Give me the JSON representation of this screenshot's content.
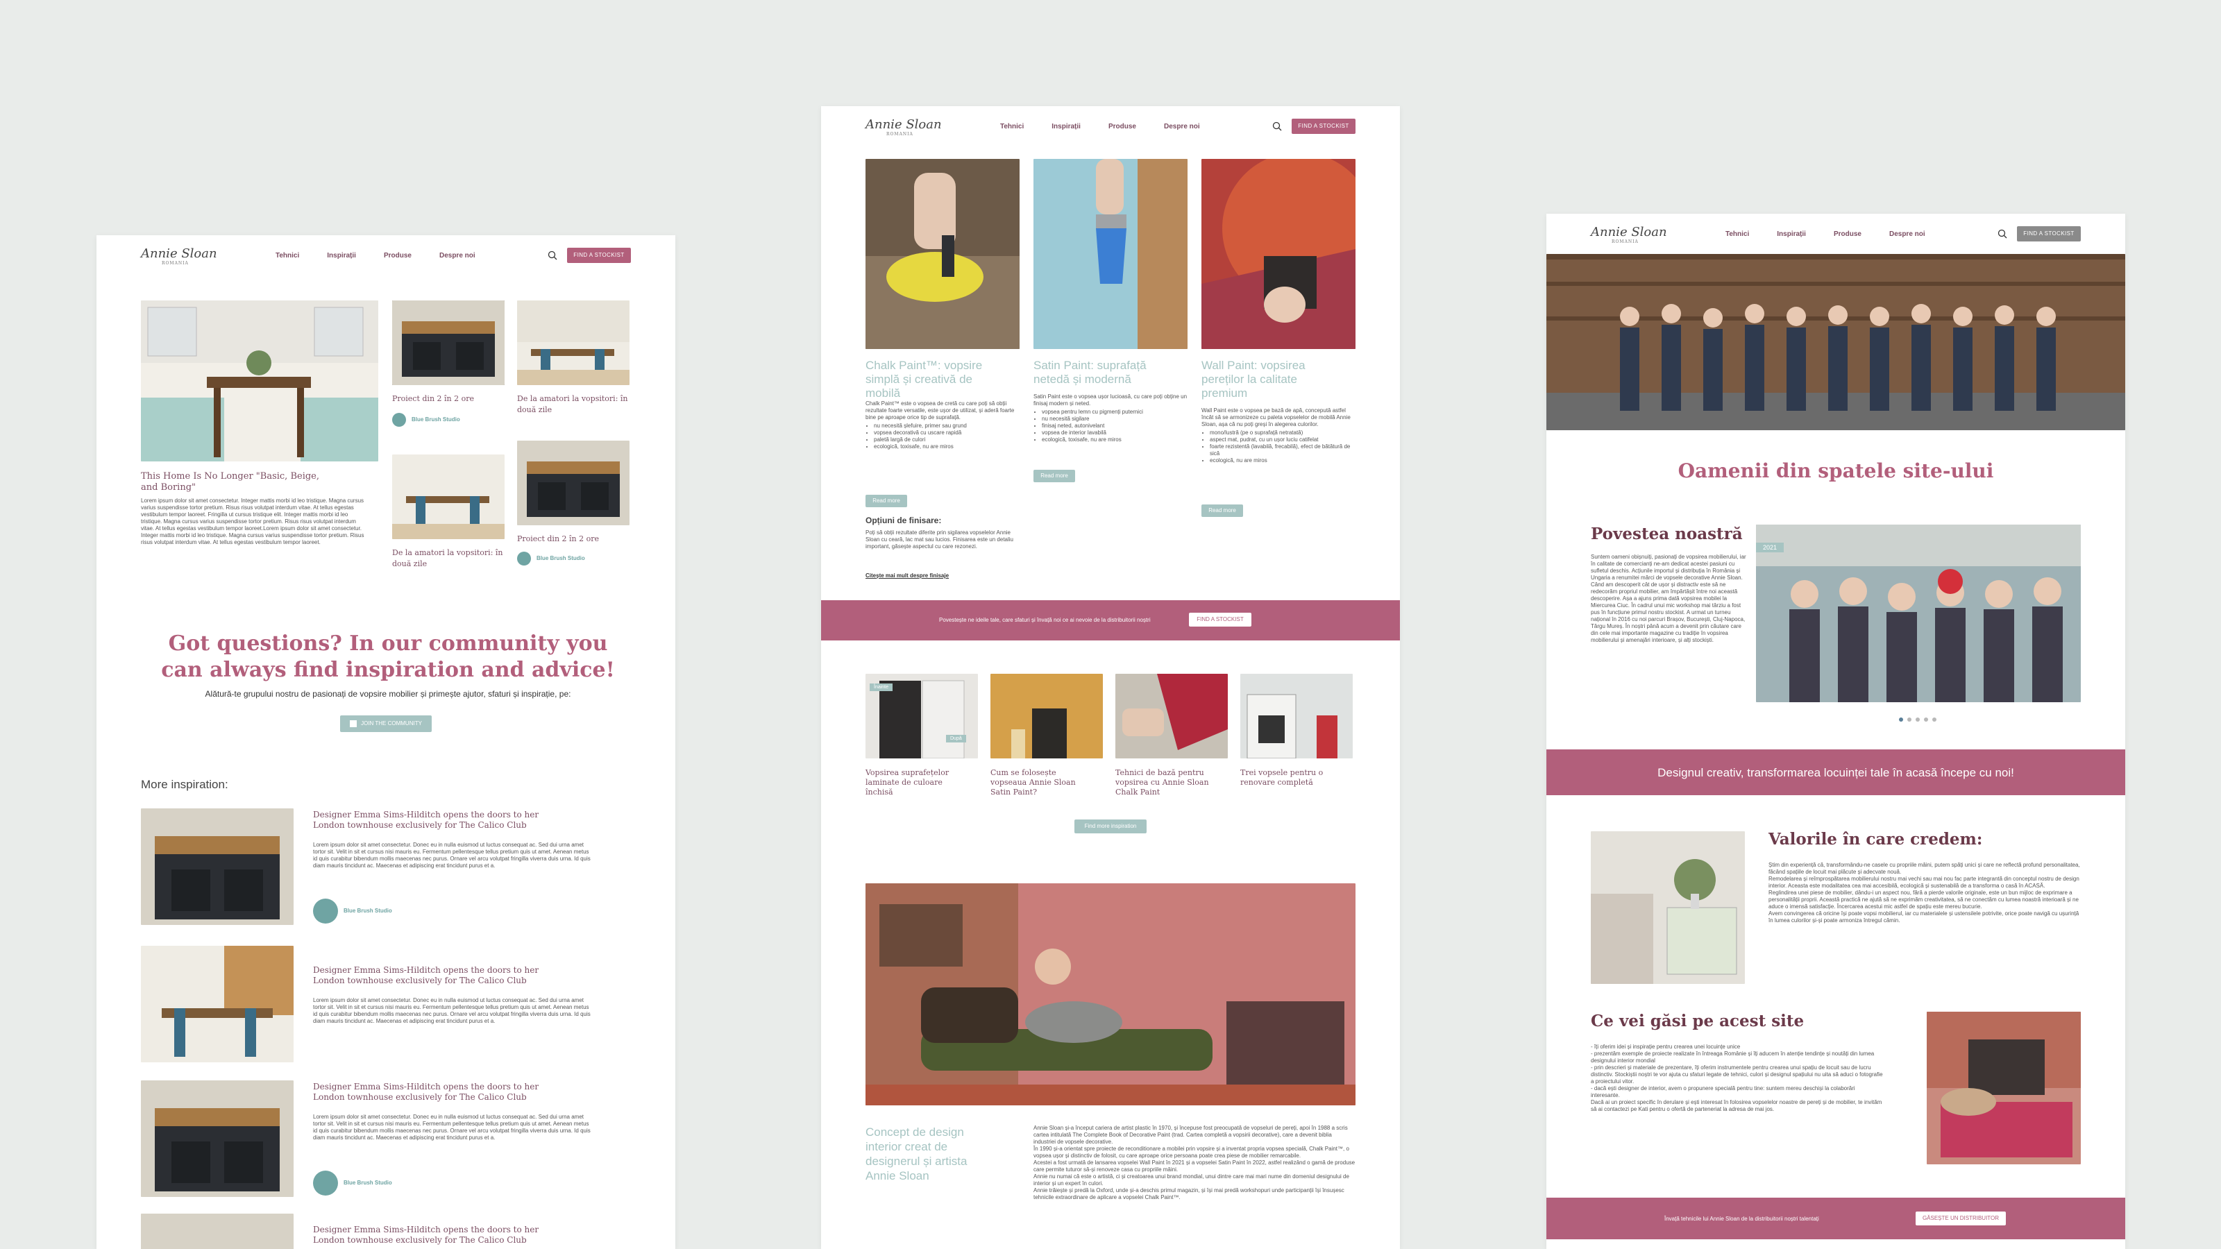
{
  "brand": {
    "logo": "Annie Sloan",
    "sub": "ROMANIA"
  },
  "nav": {
    "links": [
      "Tehnici",
      "Inspirații",
      "Produse",
      "Despre noi"
    ],
    "cta": "FIND A STOCKIST",
    "cta_alt": "FIND A STOCKIST"
  },
  "colors": {
    "accent": "#b25f7b",
    "teal": "#6fa4a3",
    "teal_light": "#a6c4c2",
    "plum": "#7b4e62",
    "gray_btn": "#8a8a8a"
  },
  "left": {
    "feature_title": "This Home Is No Longer \"Basic, Beige, and Boring\"",
    "feature_body": "Lorem ipsum dolor sit amet consectetur. Integer mattis morbi id leo tristique. Magna cursus varius suspendisse tortor pretium. Risus risus volutpat interdum vitae. At tellus egestas vestibulum tempor laoreet. Fringilla ut cursus tristique elit. Integer mattis morbi id leo tristique. Magna cursus varius suspendisse tortor pretium. Risus risus volutpat interdum vitae. At tellus egestas vestibulum tempor laoreet.Lorem ipsum dolor sit amet consectetur. Integer mattis morbi id leo tristique. Magna cursus varius suspendisse tortor pretium. Risus risus volutpat interdum vitae. At tellus egestas vestibulum tempor laoreet.",
    "cards": [
      {
        "title": "Proiect din 2 în 2 ore",
        "author": "Blue Brush Studio"
      },
      {
        "title": "De la amatori la vopsitori: în două zile"
      },
      {
        "title": "De la amatori la vopsitori: în două zile"
      },
      {
        "title": "Proiect din 2 în 2 ore",
        "author": "Blue Brush Studio"
      }
    ],
    "community_title": "Got questions? In our community you can always find inspiration and advice!",
    "community_sub": "Alătură-te grupului nostru de pasionați de vopsire mobilier și primește ajutor, sfaturi și inspirație, pe:",
    "community_btn": "JOIN THE COMMUNITY",
    "more_title": "More inspiration:",
    "list": [
      {
        "title": "Designer Emma Sims-Hilditch opens the doors to her London townhouse exclusively for The Calico Club",
        "body": "Lorem ipsum dolor sit amet consectetur. Donec eu in nulla euismod ut luctus consequat ac. Sed dui urna amet tortor sit. Velit in sit et cursus nisi mauris eu. Fermentum pellentesque tellus pretium quis ut amet. Aenean metus id quis curabitur bibendum mollis maecenas nec purus. Ornare vel arcu volutpat fringilla viverra duis urna. Id quis diam mauris tincidunt ac. Maecenas et adipiscing erat tincidunt purus et a.",
        "author": "Blue Brush Studio"
      },
      {
        "title": "Designer Emma Sims-Hilditch opens the doors to her London townhouse exclusively for The Calico Club",
        "body": "Lorem ipsum dolor sit amet consectetur. Donec eu in nulla euismod ut luctus consequat ac. Sed dui urna amet tortor sit. Velit in sit et cursus nisi mauris eu. Fermentum pellentesque tellus pretium quis ut amet. Aenean metus id quis curabitur bibendum mollis maecenas nec purus. Ornare vel arcu volutpat fringilla viverra duis urna. Id quis diam mauris tincidunt ac. Maecenas et adipiscing erat tincidunt purus et a."
      },
      {
        "title": "Designer Emma Sims-Hilditch opens the doors to her London townhouse exclusively for The Calico Club",
        "body": "Lorem ipsum dolor sit amet consectetur. Donec eu in nulla euismod ut luctus consequat ac. Sed dui urna amet tortor sit. Velit in sit et cursus nisi mauris eu. Fermentum pellentesque tellus pretium quis ut amet. Aenean metus id quis curabitur bibendum mollis maecenas nec purus. Ornare vel arcu volutpat fringilla viverra duis urna. Id quis diam mauris tincidunt ac. Maecenas et adipiscing erat tincidunt purus et a.",
        "author": "Blue Brush Studio"
      },
      {
        "title": "Designer Emma Sims-Hilditch opens the doors to her London townhouse exclusively for The Calico Club"
      }
    ]
  },
  "middle": {
    "products": [
      {
        "title": "Chalk Paint™: vopsire simplă și creativă de mobilă",
        "body": "Chalk Paint™ este o vopsea de cretă cu care poți să obții rezultate foarte versatile, este ușor de utilizat, și aderă foarte bine pe aproape orice tip de suprafață.",
        "bullets": [
          "nu necesită șlefuire, primer sau grund",
          "vopsea decorativă cu uscare rapidă",
          "paletă largă de culori",
          "ecologică, toxisafe, nu are miros"
        ],
        "btn": "Read more",
        "sub_title": "Opțiuni de finisare:",
        "sub_body": "Poți să obții rezultate diferite prin sigilarea vopselelor Annie Sloan cu ceară, lac mat sau lucios. Finisarea este un detaliu important, găsește aspectul cu care rezonezi.",
        "link": "Citește mai mult despre finisaje"
      },
      {
        "title": "Satin Paint: suprafață netedă și modernă",
        "body": "Satin Paint este o vopsea ușor lucioasă, cu care poți obține un finisaj modern și neted.",
        "bullets": [
          "vopsea pentru lemn cu pigmenți puternici",
          "nu necesită sigilare",
          "finisaj neted, autonivelant",
          "vopsea de interior lavabilă",
          "ecologică, toxisafe, nu are miros"
        ],
        "btn": "Read more"
      },
      {
        "title": "Wall Paint: vopsirea pereților la calitate premium",
        "body": "Wall Paint este o vopsea pe bază de apă, concepută astfel încât să se armonizeze cu paleta vopselelor de mobilă Annie Sloan, așa că nu poți greși în alegerea culorilor.",
        "bullets": [
          "mono/lustră (pe o suprafață netratată)",
          "aspect mat, pudrat, cu un ușor luciu catifelat",
          "foarte rezistentă (lavabilă, frecabilă), efect de bătătură de sică",
          "ecologică, nu are miros"
        ],
        "btn": "Read more"
      }
    ],
    "band_text": "Povestește ne ideile tale, care sfaturi și învață noi ce ai nevoie de la distribuitorii noștri",
    "band_btn": "FIND A STOCKIST",
    "inspo": [
      {
        "title": "Vopsirea suprafețelor laminate de culoare închisă",
        "tag1": "Înainte",
        "tag2": "După"
      },
      {
        "title": "Cum se folosește vopseaua Annie Sloan Satin Paint?"
      },
      {
        "title": "Tehnici de bază pentru vopsirea cu Annie Sloan Chalk Paint"
      },
      {
        "title": "Trei vopsele pentru o renovare completă"
      }
    ],
    "inspo_btn": "Find more inspiration",
    "concept_title": "Concept de design interior creat de designerul și artista Annie Sloan",
    "concept_body": "Annie Sloan și-a început cariera de artist plastic în 1970, și începuse fost preocupată de vopseluri de pereți, apoi în 1988 a scris cartea intitulată The Complete Book of Decorative Paint (trad. Cartea completă a vopsirii decorative), care a devenit biblia industriei de vopsele decorative.\nÎn 1990 și-a orientat spre proiecte de reconditionare a mobilei prin vopsire și a inventat propria vopsea specială, Chalk Paint™, o vopsea ușor și distinctiv de folosit, cu care aproape orice persoana poate crea piese de mobilier remarcabile.\nAcestei a fost urmată de lansarea vopselei Wall Paint în 2021 și a vopselei Satin Paint în 2022, astfel realizând o gamă de produse care permite tuturor să-și renoveze casa cu propriile mâini.\nAnnie nu numai că este o artistă, ci și creatoarea unui brand mondial, unui dintre care mai mari nume din domeniul designului de interior și un expert în culori.\nAnnie trăiește și predă la Oxford, unde și-a deschis primul magazin, și își mai predă workshopuri unde participanții își însușesc tehnicile extraordinare de aplicare a vopselei Chalk Paint™."
  },
  "right": {
    "cta": "FIND A STOCKIST",
    "about_title": "Oamenii din spatele site-ului",
    "story_title": "Povestea noastră",
    "story_body": "Suntem oameni obișnuiți, pasionați de vopsirea mobilierului, iar în calitate de comercianți ne-am dedicat acestei pasiuni cu sufletul deschis. Acțiunile importul și distribuția în România și Ungaria a renumitei mărci de vopsele decorative Annie Sloan.\nCând am descoperit cât de ușor și distractiv este să ne redecorăm propriul mobilier, am împărtășit între noi această descoperire. Așa a ajuns prima dată vopsirea mobilei la Miercurea Ciuc. În cadrul unui mic workshop mai târziu a fost pus în funcțiune primul nostru stockist. A urmat un turneu național în 2016 cu noi parcuri Brașov, București, Cluj-Napoca, Târgu Mureș. În noștri până acum a devenit prin căutare care din cele mai importante magazine cu tradiție în vopsirea mobilierului și amenajări interioare, și alți stockiști.",
    "year_tag": "2021",
    "band": "Designul creativ, transformarea locuinței tale în acasă începe cu noi!",
    "values_title": "Valorile în care credem:",
    "values_body": "Știm din experiență că, transformându-ne casele cu propriile mâini, putem spăți unici și care ne reflectă profund personalitatea, făcând spațiile de locuit mai plăcute și adecvate nouă.\nRemodelarea și reîmprospătarea mobilierului nostru mai vechi sau mai nou fac parte integrantă din conceptul nostru de design interior. Aceasta este modalitatea cea mai accesibilă, ecologică și sustenabilă de a transforma o casă în ACASĂ.\nReglindirea unei piese de mobilier, dându-i un aspect nou, fără a pierde valorile originale, este un bun mijloc de exprimare a personalității proprii. Această practică ne ajută să ne exprimăm creativitatea, să ne conectăm cu lumea noastră interioară și ne aduce o imensă satisfacție. Încercarea acestui mic astfel de spațiu este mereu bucurie.\nAvem convingerea că oricine își poate vopsi mobilierul, iar cu materialele și ustensilele potrivite, orice poate navigă cu ușurință în lumea culorilor și-și poate armoniza întregul cămin.",
    "find_title": "Ce vei găsi pe acest site",
    "find_body": "- îți oferim idei și inspirație pentru crearea unei locuințe unice\n- prezentăm exemple de proiecte realizate în întreaga Românie și îți aducem în atenție tendințe și noutăți din lumea designului interior mondial\n- prin descrieri și materiale de prezentare, îți oferim instrumentele pentru crearea unui spațiu de locuit sau de lucru distinctiv. Stockiștii noștri te vor ajuta cu sfaturi legate de tehnici, culori și designul spațiului nu uita să aduci o fotografie a proiectului vitor.\n- dacă ești designer de interior, avem o propunere specială pentru tine: suntem mereu deschiși la colaborări interesante.\nDacă ai un proiect specific în derulare și ești interesat în folosirea vopselelor noastre de pereți și de mobilier, te invităm să ai contactezi pe Kati pentru o ofertă de parteneriat la adresa de mai jos.",
    "footer_text": "Învață tehnicile lui Annie Sloan de la distribuitorii noștri talentați",
    "footer_btn": "GĂSEȘTE UN DISTRIBUITOR"
  }
}
